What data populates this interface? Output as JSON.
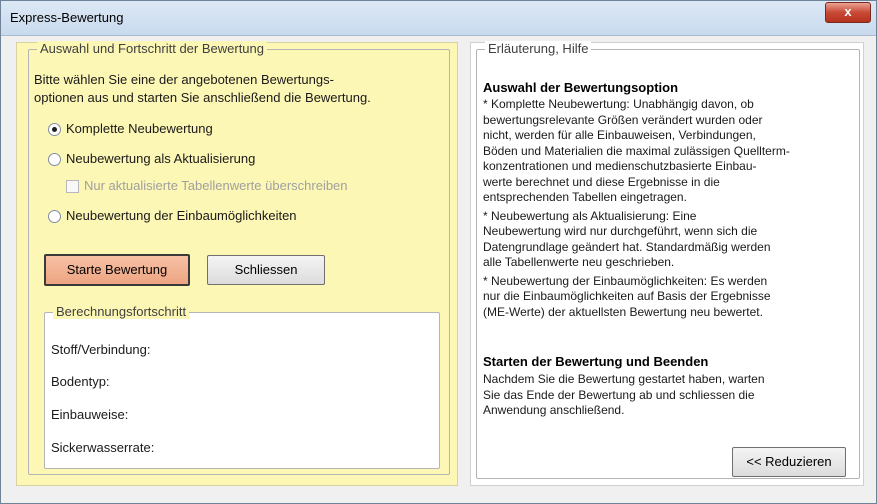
{
  "window": {
    "title": "Express-Bewertung",
    "close_label": "x"
  },
  "left": {
    "group_title": "Auswahl und Fortschritt der Bewertung",
    "instructions": [
      "Bitte wählen Sie eine der angebotenen Bewertungs-",
      "optionen aus und starten Sie anschließend die Bewertung."
    ],
    "options": {
      "komplett": "Komplette Neubewertung",
      "aktualisierung": "Neubewertung als Aktualisierung",
      "ueberschreiben": "Nur aktualisierte Tabellenwerte überschreiben",
      "einbau": "Neubewertung der Einbaumöglichkeiten"
    },
    "selected_option": "komplett",
    "buttons": {
      "start": "Starte Bewertung",
      "close": "Schliessen"
    },
    "progress": {
      "title": "Berechnungsfortschritt",
      "stoff": "Stoff/Verbindung:",
      "boden": "Bodentyp:",
      "einbauweise": "Einbauweise:",
      "sicker": "Sickerwasserrate:"
    }
  },
  "help": {
    "title": "Erläuterung, Hilfe",
    "heading1": "Auswahl der Bewertungsoption",
    "lines1": [
      "* Komplette Neubewertung: Unabhängig davon, ob",
      "bewertungsrelevante Größen verändert wurden oder",
      "nicht, werden für alle Einbauweisen, Verbindungen,",
      "Böden und Materialien die maximal zulässigen Quellterm-",
      "konzentrationen und medienschutzbasierte Einbau-",
      "werte berechnet und diese Ergebnisse in die",
      "entsprechenden Tabellen eingetragen.",
      "* Neubewertung als Aktualisierung: Eine",
      "Neubewertung wird nur durchgeführt, wenn sich die",
      "Datengrundlage geändert hat. Standardmäßig werden",
      "alle Tabellenwerte neu geschrieben.",
      "* Neubewertung der Einbaumöglichkeiten: Es werden",
      "nur die Einbaumöglichkeiten auf Basis der Ergebnisse",
      "(ME-Werte) der aktuellsten Bewertung neu bewertet."
    ],
    "heading2": "Starten der Bewertung und Beenden",
    "lines2": [
      "Nachdem Sie die Bewertung gestartet haben, warten",
      "Sie das Ende der Bewertung ab und schliessen die",
      "Anwendung anschließend."
    ],
    "reduce_label": "<< Reduzieren"
  }
}
